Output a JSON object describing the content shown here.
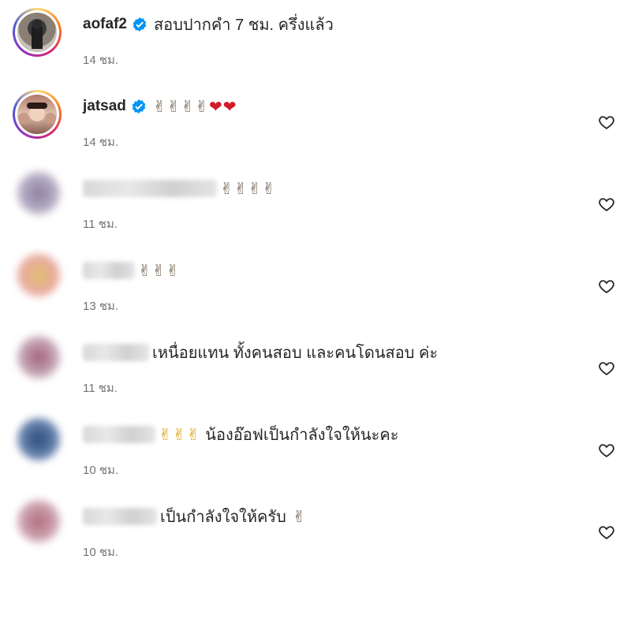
{
  "comments": [
    {
      "username": "aofaf2",
      "verified": true,
      "text": "สอบปากคำ 7 ชม. ครึ่งแล้ว",
      "emoji": "",
      "time": "14 ชม.",
      "has_like": false
    },
    {
      "username": "jatsad",
      "verified": true,
      "text": "",
      "emoji": "✌✌✌✌",
      "emoji2": "❤❤",
      "time": "14 ชม.",
      "has_like": true
    },
    {
      "username": "",
      "verified": false,
      "text": "",
      "emoji": "✌✌✌✌",
      "time": "11 ชม.",
      "has_like": true
    },
    {
      "username": "",
      "verified": false,
      "text": "",
      "emoji": "✌✌✌",
      "time": "13 ชม.",
      "has_like": true
    },
    {
      "username": "",
      "verified": false,
      "text": "เหนื่อยแทน ทั้งคนสอบ และคนโดนสอบ ค่ะ",
      "emoji": "",
      "time": "11 ชม.",
      "has_like": true
    },
    {
      "username": "",
      "verified": false,
      "text": "น้องอ๊อฟเป็นกำลังใจให้นะคะ",
      "emoji": "✌✌✌",
      "time": "10 ชม.",
      "has_like": true
    },
    {
      "username": "",
      "verified": false,
      "text": "เป็นกำลังใจให้ครับ",
      "emoji": "✌",
      "time": "10 ชม.",
      "has_like": true
    }
  ],
  "colors": {
    "verified": "#0095f6",
    "time": "#737373",
    "text": "#262626"
  },
  "icons": {
    "like": "heart-outline-icon",
    "verified": "verified-badge-icon"
  }
}
